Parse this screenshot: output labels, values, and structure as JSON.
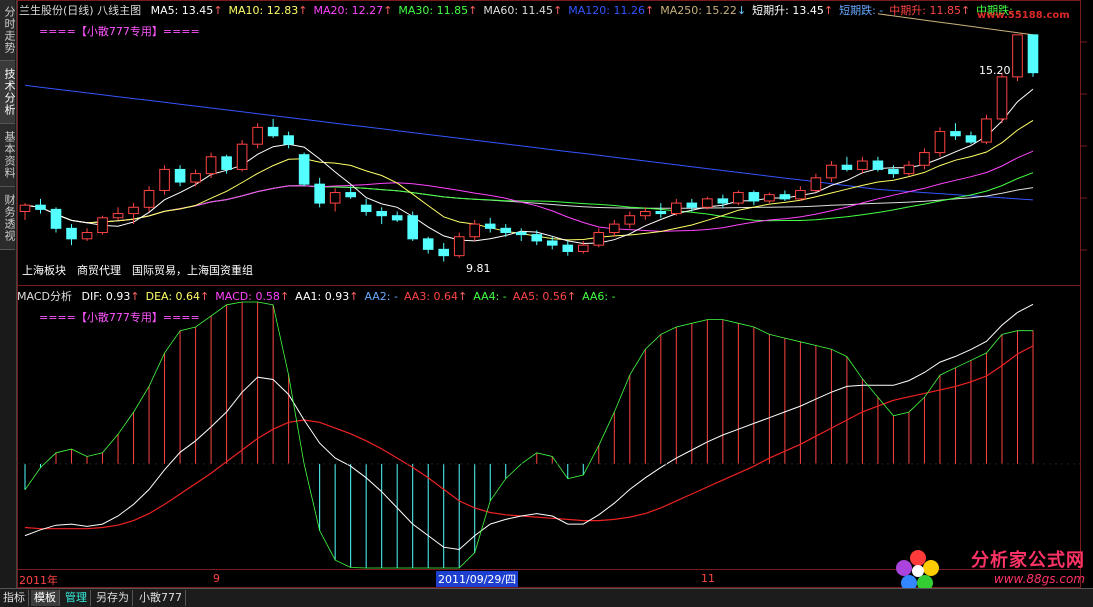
{
  "side_tabs": [
    "分时走势",
    "技术分析",
    "基本资料",
    "财务透视"
  ],
  "header": {
    "title": "兰生股份(日线)",
    "main_name": "八线主图",
    "ma_items": [
      {
        "label": "MA5: 13.45",
        "arrow": "↑",
        "color": "#ffffff",
        "arrow_color": "#ff6060"
      },
      {
        "label": "MA10: 12.83",
        "arrow": "↑",
        "color": "#ffff66",
        "arrow_color": "#ff6060"
      },
      {
        "label": "MA20: 12.27",
        "arrow": "↑",
        "color": "#ff44ff",
        "arrow_color": "#ff6060"
      },
      {
        "label": "MA30: 11.85",
        "arrow": "↑",
        "color": "#44ff44",
        "arrow_color": "#ff6060"
      },
      {
        "label": "MA60: 11.45",
        "arrow": "↑",
        "color": "#dddddd",
        "arrow_color": "#ff6060"
      },
      {
        "label": "MA120: 11.26",
        "arrow": "↑",
        "color": "#3355ff",
        "arrow_color": "#ff6060"
      },
      {
        "label": "MA250: 15.22",
        "arrow": "↓",
        "color": "#c8b27a",
        "arrow_color": "#66ccff"
      },
      {
        "label": "短期升: 13.45",
        "arrow": "↑",
        "color": "#ffffff",
        "arrow_color": "#ff6060"
      },
      {
        "label": "短期跌: -",
        "arrow": "",
        "color": "#66aaff",
        "arrow_color": "#66aaff"
      },
      {
        "label": "中期升: 11.85",
        "arrow": "↑",
        "color": "#ff4444",
        "arrow_color": "#ff6060"
      },
      {
        "label": "中期跌: -",
        "arrow": "",
        "color": "#44ff44",
        "arrow_color": "#44ff44"
      }
    ],
    "special_note": "====【小散777专用】===="
  },
  "price_labels": {
    "high": "15.20",
    "low": "9.81"
  },
  "concept": "上海板块　商贸代理　国际贸易，上海国资重组",
  "macd_header": {
    "name": "MACD分析",
    "items": [
      {
        "label": "DIF: 0.93",
        "arrow": "↑",
        "color": "#ffffff"
      },
      {
        "label": "DEA: 0.64",
        "arrow": "↑",
        "color": "#ffff66"
      },
      {
        "label": "MACD: 0.58",
        "arrow": "↑",
        "color": "#ff44ff"
      },
      {
        "label": "AA1: 0.93",
        "arrow": "↑",
        "color": "#ffffff"
      },
      {
        "label": "AA2: -",
        "arrow": "",
        "color": "#66aaff"
      },
      {
        "label": "AA3: 0.64",
        "arrow": "↑",
        "color": "#ff4444"
      },
      {
        "label": "AA4: -",
        "arrow": "",
        "color": "#44ff44"
      },
      {
        "label": "AA5: 0.56",
        "arrow": "↑",
        "color": "#ff4444"
      },
      {
        "label": "AA6: -",
        "arrow": "",
        "color": "#44ff44"
      }
    ],
    "special_note": "====【小散777专用】===="
  },
  "date_axis": {
    "year": "2011年",
    "m9": "9",
    "cursor": "2011/09/29/四",
    "m11": "11"
  },
  "bottom_tabs": [
    "指标",
    "模板",
    "管理",
    "另存为",
    "小散777"
  ],
  "watermark": {
    "top": "www.55188.com",
    "name": "分析家公式网",
    "url": "www.88gs.com"
  },
  "colors": {
    "up": "#ff4444",
    "down": "#54ffff",
    "ma5": "#ffffff",
    "ma10": "#ffff66",
    "ma20": "#ff44ff",
    "ma30": "#44ff44",
    "ma60": "#dddddd",
    "ma120": "#3355ff",
    "ma250": "#c8b27a"
  },
  "chart_data": {
    "type": "candlestick",
    "price_axis": {
      "min": 9.3,
      "max": 15.6
    },
    "candles": [
      {
        "o": 11.0,
        "h": 11.2,
        "l": 10.8,
        "c": 11.15
      },
      {
        "o": 11.15,
        "h": 11.3,
        "l": 10.95,
        "c": 11.05
      },
      {
        "o": 11.05,
        "h": 11.1,
        "l": 10.5,
        "c": 10.6
      },
      {
        "o": 10.6,
        "h": 10.7,
        "l": 10.2,
        "c": 10.35
      },
      {
        "o": 10.35,
        "h": 10.6,
        "l": 10.3,
        "c": 10.5
      },
      {
        "o": 10.5,
        "h": 10.9,
        "l": 10.45,
        "c": 10.85
      },
      {
        "o": 10.85,
        "h": 11.1,
        "l": 10.8,
        "c": 10.95
      },
      {
        "o": 10.95,
        "h": 11.2,
        "l": 10.7,
        "c": 11.1
      },
      {
        "o": 11.1,
        "h": 11.6,
        "l": 11.0,
        "c": 11.5
      },
      {
        "o": 11.5,
        "h": 12.1,
        "l": 11.4,
        "c": 12.0
      },
      {
        "o": 12.0,
        "h": 12.1,
        "l": 11.6,
        "c": 11.7
      },
      {
        "o": 11.7,
        "h": 12.0,
        "l": 11.6,
        "c": 11.9
      },
      {
        "o": 11.9,
        "h": 12.4,
        "l": 11.8,
        "c": 12.3
      },
      {
        "o": 12.3,
        "h": 12.35,
        "l": 11.9,
        "c": 12.0
      },
      {
        "o": 12.0,
        "h": 12.7,
        "l": 11.95,
        "c": 12.6
      },
      {
        "o": 12.6,
        "h": 13.1,
        "l": 12.5,
        "c": 13.0
      },
      {
        "o": 13.0,
        "h": 13.2,
        "l": 12.75,
        "c": 12.8
      },
      {
        "o": 12.8,
        "h": 12.9,
        "l": 12.5,
        "c": 12.6
      },
      {
        "o": 12.35,
        "h": 12.4,
        "l": 11.6,
        "c": 11.65
      },
      {
        "o": 11.65,
        "h": 11.8,
        "l": 11.1,
        "c": 11.2
      },
      {
        "o": 11.2,
        "h": 11.55,
        "l": 11.0,
        "c": 11.45
      },
      {
        "o": 11.45,
        "h": 11.6,
        "l": 11.3,
        "c": 11.35
      },
      {
        "o": 11.15,
        "h": 11.3,
        "l": 10.9,
        "c": 11.0
      },
      {
        "o": 11.0,
        "h": 11.1,
        "l": 10.7,
        "c": 10.9
      },
      {
        "o": 10.9,
        "h": 11.0,
        "l": 10.75,
        "c": 10.8
      },
      {
        "o": 10.9,
        "h": 11.0,
        "l": 10.3,
        "c": 10.35
      },
      {
        "o": 10.35,
        "h": 10.4,
        "l": 10.0,
        "c": 10.1
      },
      {
        "o": 10.1,
        "h": 10.25,
        "l": 9.81,
        "c": 9.95
      },
      {
        "o": 9.95,
        "h": 10.5,
        "l": 9.9,
        "c": 10.4
      },
      {
        "o": 10.4,
        "h": 10.8,
        "l": 10.3,
        "c": 10.7
      },
      {
        "o": 10.7,
        "h": 10.85,
        "l": 10.5,
        "c": 10.6
      },
      {
        "o": 10.6,
        "h": 10.7,
        "l": 10.4,
        "c": 10.5
      },
      {
        "o": 10.5,
        "h": 10.6,
        "l": 10.3,
        "c": 10.45
      },
      {
        "o": 10.45,
        "h": 10.55,
        "l": 10.2,
        "c": 10.3
      },
      {
        "o": 10.3,
        "h": 10.4,
        "l": 10.1,
        "c": 10.2
      },
      {
        "o": 10.2,
        "h": 10.3,
        "l": 9.95,
        "c": 10.05
      },
      {
        "o": 10.05,
        "h": 10.3,
        "l": 10.0,
        "c": 10.2
      },
      {
        "o": 10.2,
        "h": 10.6,
        "l": 10.15,
        "c": 10.5
      },
      {
        "o": 10.5,
        "h": 10.8,
        "l": 10.4,
        "c": 10.7
      },
      {
        "o": 10.7,
        "h": 11.0,
        "l": 10.6,
        "c": 10.9
      },
      {
        "o": 10.9,
        "h": 11.1,
        "l": 10.8,
        "c": 11.0
      },
      {
        "o": 11.0,
        "h": 11.2,
        "l": 10.85,
        "c": 10.95
      },
      {
        "o": 10.95,
        "h": 11.3,
        "l": 10.9,
        "c": 11.2
      },
      {
        "o": 11.2,
        "h": 11.3,
        "l": 11.0,
        "c": 11.1
      },
      {
        "o": 11.1,
        "h": 11.35,
        "l": 11.05,
        "c": 11.3
      },
      {
        "o": 11.3,
        "h": 11.4,
        "l": 11.1,
        "c": 11.2
      },
      {
        "o": 11.2,
        "h": 11.5,
        "l": 11.15,
        "c": 11.45
      },
      {
        "o": 11.45,
        "h": 11.5,
        "l": 11.15,
        "c": 11.25
      },
      {
        "o": 11.25,
        "h": 11.45,
        "l": 11.2,
        "c": 11.4
      },
      {
        "o": 11.4,
        "h": 11.5,
        "l": 11.25,
        "c": 11.3
      },
      {
        "o": 11.3,
        "h": 11.6,
        "l": 11.25,
        "c": 11.5
      },
      {
        "o": 11.5,
        "h": 11.9,
        "l": 11.45,
        "c": 11.8
      },
      {
        "o": 11.8,
        "h": 12.2,
        "l": 11.7,
        "c": 12.1
      },
      {
        "o": 12.1,
        "h": 12.3,
        "l": 11.95,
        "c": 12.0
      },
      {
        "o": 12.0,
        "h": 12.3,
        "l": 11.9,
        "c": 12.2
      },
      {
        "o": 12.2,
        "h": 12.3,
        "l": 11.95,
        "c": 12.0
      },
      {
        "o": 12.0,
        "h": 12.1,
        "l": 11.8,
        "c": 11.9
      },
      {
        "o": 11.9,
        "h": 12.2,
        "l": 11.85,
        "c": 12.1
      },
      {
        "o": 12.1,
        "h": 12.5,
        "l": 12.0,
        "c": 12.4
      },
      {
        "o": 12.4,
        "h": 13.0,
        "l": 12.3,
        "c": 12.9
      },
      {
        "o": 12.9,
        "h": 13.1,
        "l": 12.7,
        "c": 12.8
      },
      {
        "o": 12.8,
        "h": 12.9,
        "l": 12.6,
        "c": 12.65
      },
      {
        "o": 12.65,
        "h": 13.3,
        "l": 12.6,
        "c": 13.2
      },
      {
        "o": 13.2,
        "h": 14.3,
        "l": 13.1,
        "c": 14.2
      },
      {
        "o": 14.2,
        "h": 15.2,
        "l": 14.1,
        "c": 15.2
      },
      {
        "o": 15.2,
        "h": 15.2,
        "l": 14.2,
        "c": 14.3
      }
    ],
    "macd": {
      "range": [
        -0.9,
        1.4
      ],
      "dif": [
        -0.62,
        -0.57,
        -0.53,
        -0.52,
        -0.54,
        -0.52,
        -0.45,
        -0.35,
        -0.22,
        -0.05,
        0.1,
        0.2,
        0.32,
        0.45,
        0.62,
        0.75,
        0.73,
        0.6,
        0.38,
        0.18,
        0.05,
        -0.02,
        -0.12,
        -0.24,
        -0.38,
        -0.52,
        -0.62,
        -0.72,
        -0.74,
        -0.62,
        -0.52,
        -0.48,
        -0.45,
        -0.43,
        -0.45,
        -0.52,
        -0.52,
        -0.44,
        -0.34,
        -0.22,
        -0.12,
        -0.03,
        0.05,
        0.12,
        0.19,
        0.25,
        0.3,
        0.35,
        0.4,
        0.45,
        0.5,
        0.56,
        0.62,
        0.67,
        0.68,
        0.68,
        0.68,
        0.72,
        0.79,
        0.88,
        0.93,
        0.99,
        1.06,
        1.2,
        1.31,
        1.38
      ],
      "dea": [
        -0.55,
        -0.56,
        -0.56,
        -0.56,
        -0.56,
        -0.55,
        -0.53,
        -0.49,
        -0.43,
        -0.35,
        -0.26,
        -0.17,
        -0.08,
        0.02,
        0.12,
        0.22,
        0.3,
        0.36,
        0.38,
        0.36,
        0.31,
        0.26,
        0.2,
        0.13,
        0.05,
        -0.03,
        -0.12,
        -0.22,
        -0.32,
        -0.38,
        -0.42,
        -0.44,
        -0.45,
        -0.46,
        -0.47,
        -0.48,
        -0.49,
        -0.49,
        -0.48,
        -0.46,
        -0.43,
        -0.38,
        -0.32,
        -0.26,
        -0.2,
        -0.14,
        -0.08,
        -0.02,
        0.05,
        0.11,
        0.17,
        0.24,
        0.31,
        0.38,
        0.45,
        0.5,
        0.55,
        0.58,
        0.61,
        0.64,
        0.67,
        0.71,
        0.76,
        0.85,
        0.95,
        1.02
      ]
    }
  }
}
